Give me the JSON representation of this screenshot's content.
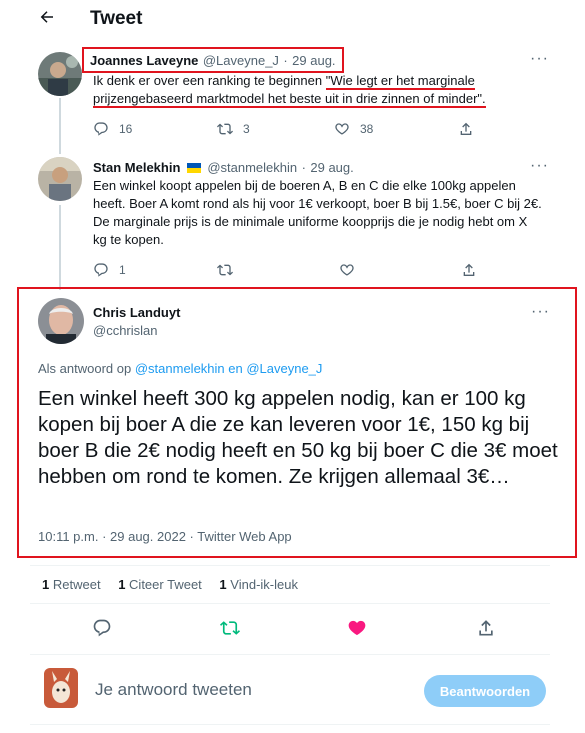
{
  "header": {
    "back_icon": "arrow-left-icon",
    "title": "Tweet"
  },
  "tweets": [
    {
      "name": "Joannes Laveyne",
      "handle": "@Laveyne_J",
      "sep": "·",
      "time": "29 aug.",
      "text_plain": "Ik denk er over een ranking te beginnen ",
      "text_quote": "\"Wie legt er het marginale prijzengebaseerd marktmodel het beste uit in drie zinnen of minder\".",
      "replies": "16",
      "retweets": "3",
      "likes": "38"
    },
    {
      "name": "Stan Melekhin",
      "flag": "🇺🇦",
      "handle": "@stanmelekhin",
      "sep": "·",
      "time": "29 aug.",
      "text": "Een winkel koopt appelen bij de boeren A, B en C die elke 100kg appelen heeft. Boer A komt rond als hij voor 1€ verkoopt, boer B bij 1.5€, boer C bij 2€. De marginale prijs is de minimale uniforme koopprijs die je nodig hebt om X kg te kopen.",
      "replies": "1",
      "retweets": "",
      "likes": ""
    }
  ],
  "main_tweet": {
    "name": "Chris Landuyt",
    "handle": "@cchrislan",
    "reply_prefix": "Als antwoord op",
    "reply_to": "@stanmelekhin en @Laveyne_J",
    "text": "Een winkel heeft 300 kg appelen nodig, kan er 100 kg kopen bij boer A die ze kan leveren voor 1€, 150 kg bij boer B die 2€ nodig heeft en 50 kg bij boer C die 3€ moet hebben om rond te komen. Ze krijgen allemaal 3€…",
    "timestamp": "10:11 p.m. · 29 aug. 2022 · Twitter Web App"
  },
  "stats": {
    "retweets_count": "1",
    "retweets_label": "Retweet",
    "quotes_count": "1",
    "quotes_label": "Citeer Tweet",
    "likes_count": "1",
    "likes_label": "Vind-ik-leuk"
  },
  "composer": {
    "placeholder": "Je antwoord tweeten",
    "button": "Beantwoorden"
  },
  "colors": {
    "accent": "#1d9bf0",
    "like": "#f91880",
    "retweet": "#00ba7c",
    "highlight": "#e0141e"
  }
}
